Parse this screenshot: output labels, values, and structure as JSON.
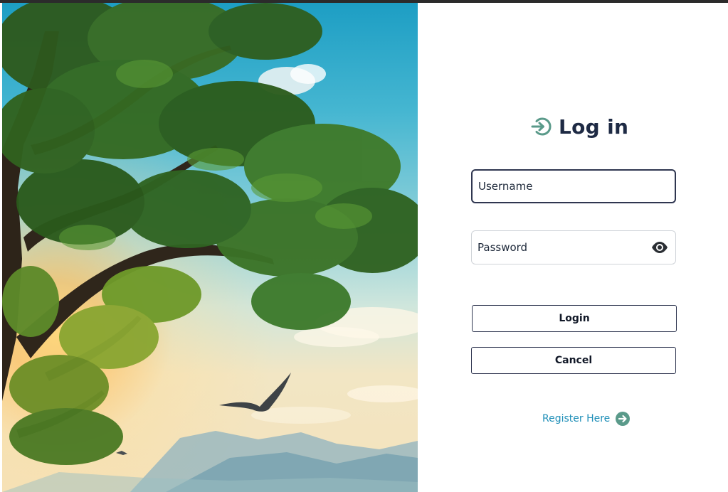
{
  "header": {
    "title": "Log in",
    "icon": "login-icon"
  },
  "form": {
    "username_placeholder": "Username",
    "password_placeholder": "Password",
    "password_toggle_icon": "eye-icon"
  },
  "buttons": {
    "login": "Login",
    "cancel": "Cancel"
  },
  "register": {
    "label": "Register Here",
    "icon": "arrow-right-circle-icon"
  },
  "colors": {
    "accent": "#5a9a8a",
    "title": "#1e2a44",
    "link": "#1f8fb8",
    "border": "#2f3650",
    "input_border": "#cfd3d8"
  }
}
